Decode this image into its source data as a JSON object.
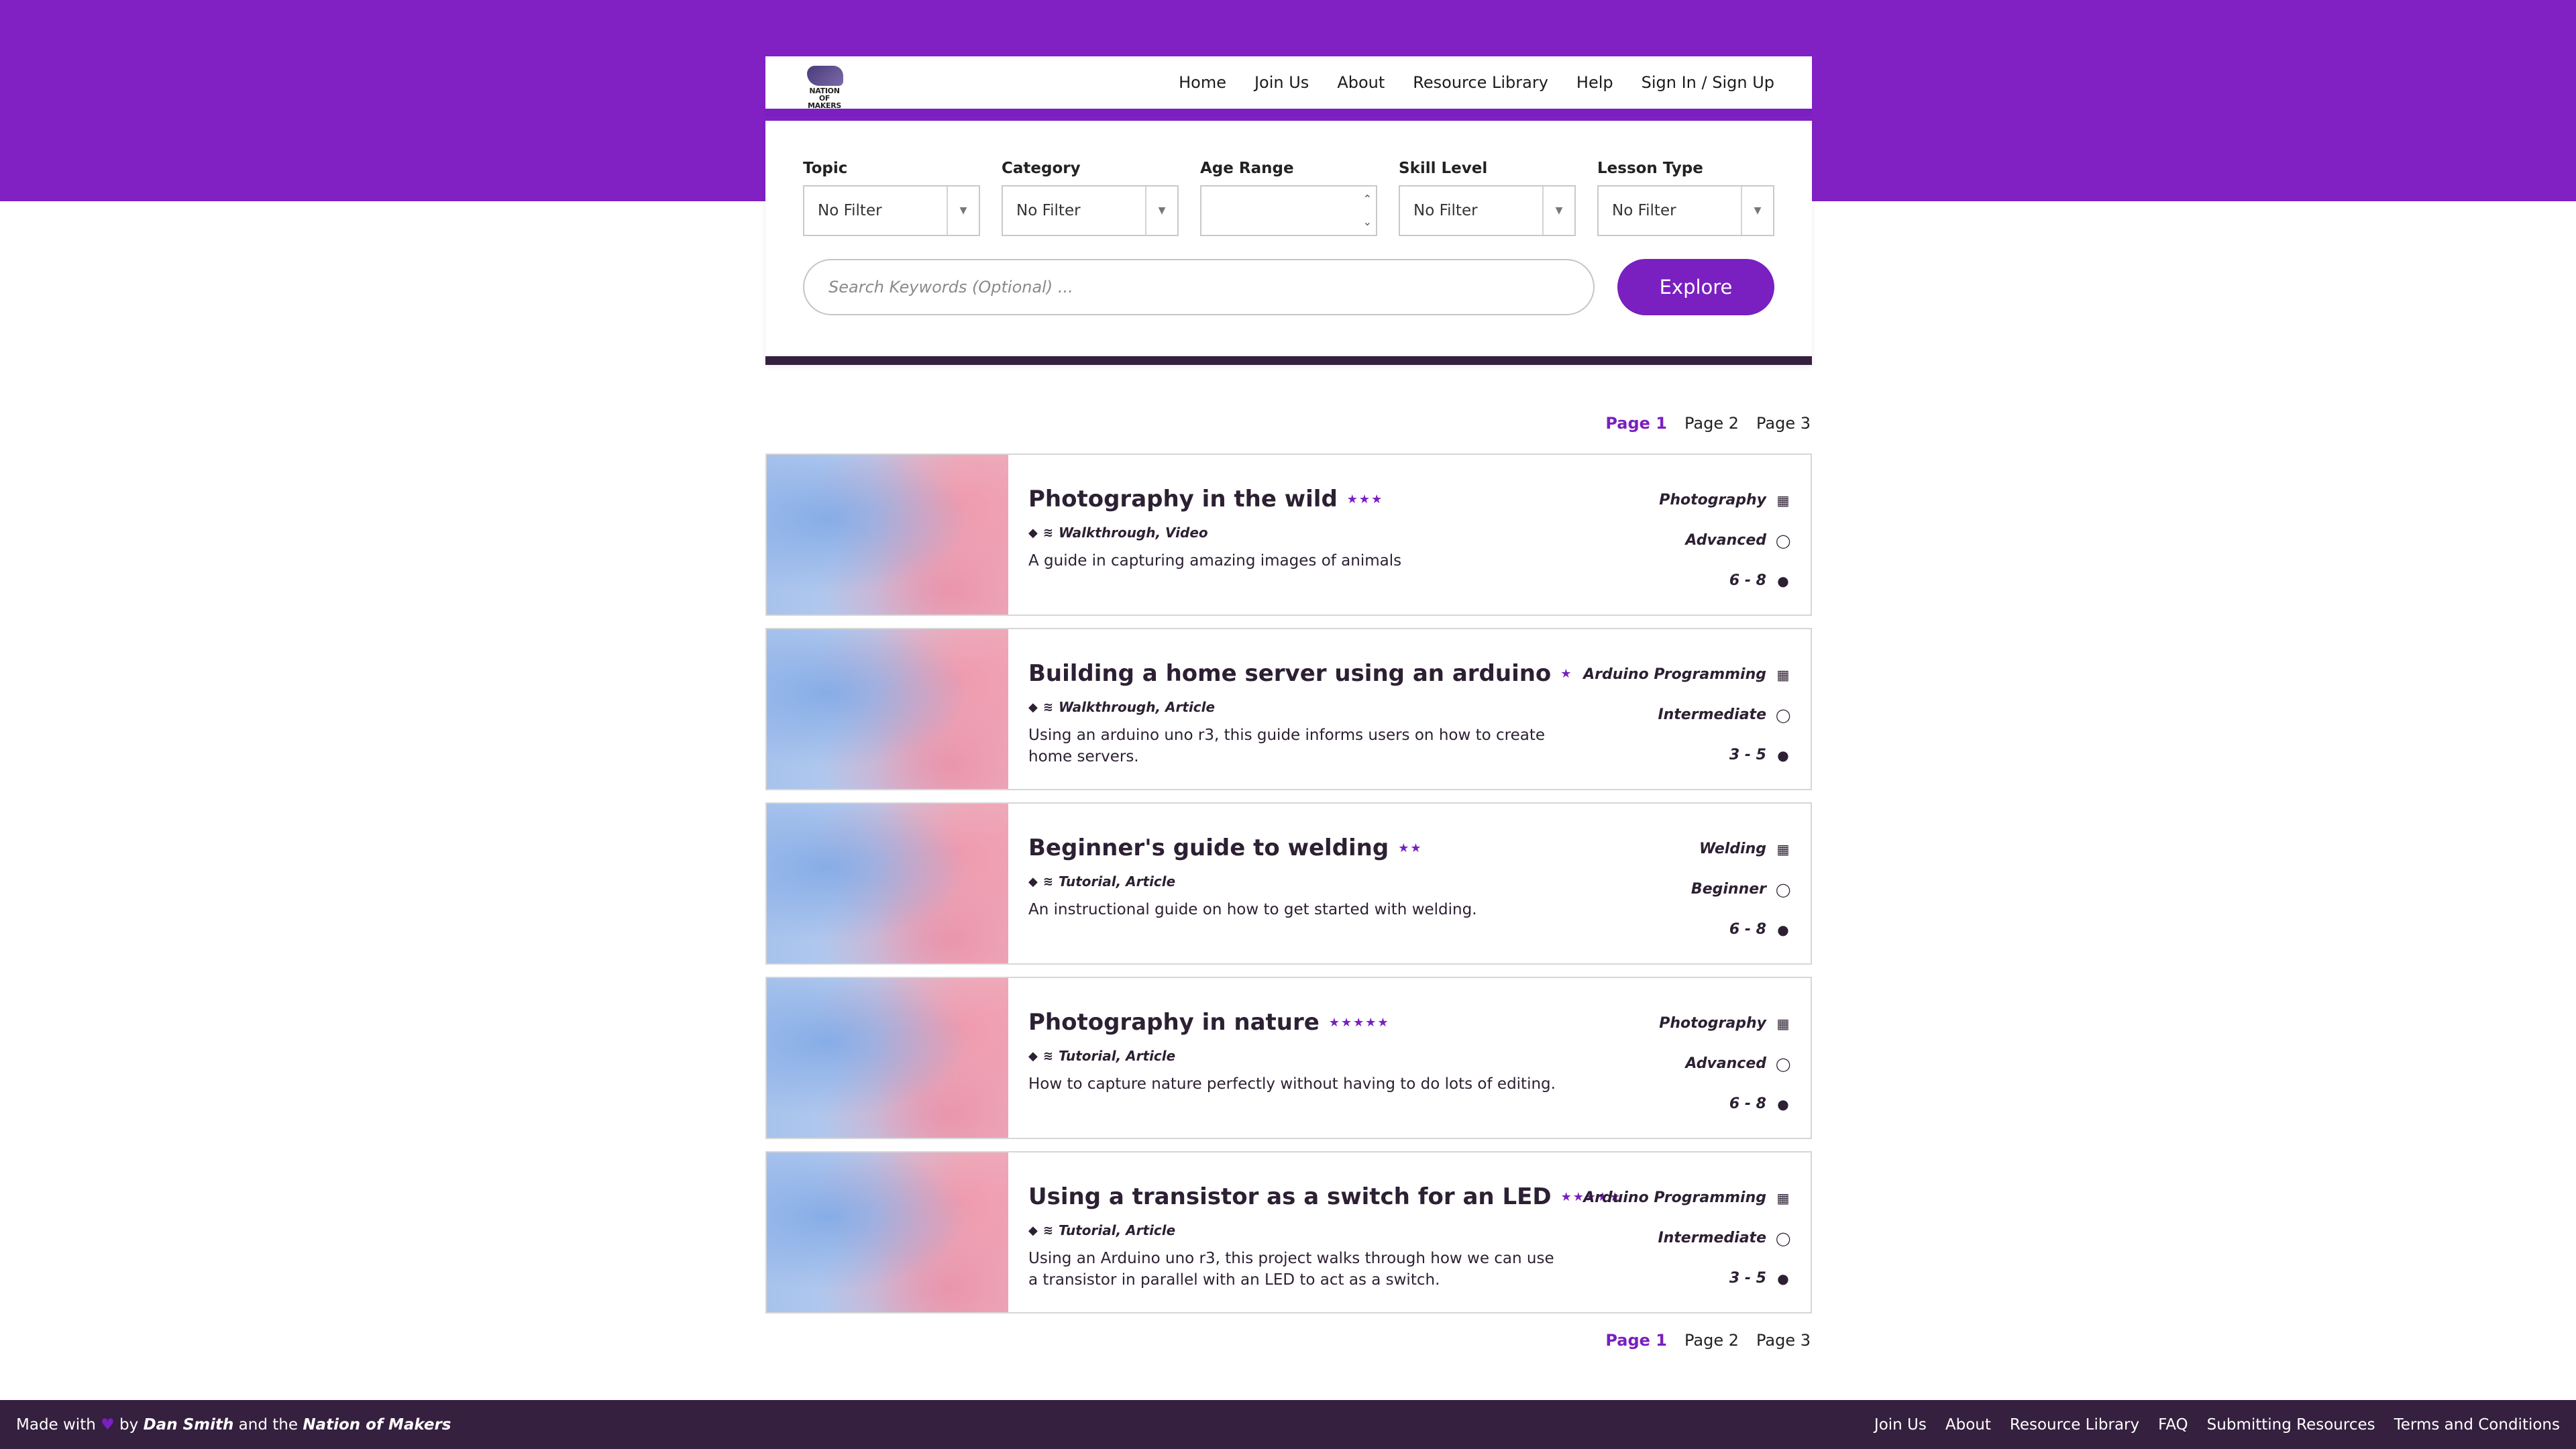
{
  "brand": {
    "logo_text": "NATION OF MAKERS"
  },
  "nav": {
    "items": [
      "Home",
      "Join Us",
      "About",
      "Resource Library",
      "Help",
      "Sign In / Sign Up"
    ]
  },
  "filters": {
    "topic": {
      "label": "Topic",
      "value": "No Filter"
    },
    "category": {
      "label": "Category",
      "value": "No Filter"
    },
    "age_range": {
      "label": "Age Range",
      "value": ""
    },
    "skill_level": {
      "label": "Skill Level",
      "value": "No Filter"
    },
    "lesson_type": {
      "label": "Lesson Type",
      "value": "No Filter"
    }
  },
  "search": {
    "placeholder": "Search Keywords (Optional) ...",
    "button": "Explore"
  },
  "pagination": {
    "pages": [
      "Page 1",
      "Page 2",
      "Page 3"
    ],
    "current": "Page 1"
  },
  "resources": [
    {
      "title": "Photography in the wild",
      "stars": "★★★",
      "types": "Walkthrough, Video",
      "description": "A guide in capturing amazing images of animals",
      "category": "Photography",
      "skill": "Advanced",
      "ages": "6 - 8"
    },
    {
      "title": "Building a home server using an arduino",
      "stars": "★",
      "types": "Walkthrough, Article",
      "description": "Using an arduino uno r3, this guide informs users on how to create home servers.",
      "category": "Arduino Programming",
      "skill": "Intermediate",
      "ages": "3 - 5"
    },
    {
      "title": "Beginner's guide to welding",
      "stars": "★★",
      "types": "Tutorial, Article",
      "description": "An instructional guide on how to get started with welding.",
      "category": "Welding",
      "skill": "Beginner",
      "ages": "6 - 8"
    },
    {
      "title": "Photography in nature",
      "stars": "★★★★★",
      "types": "Tutorial, Article",
      "description": "How to capture nature perfectly without having to do lots of editing.",
      "category": "Photography",
      "skill": "Advanced",
      "ages": "6 - 8"
    },
    {
      "title": "Using a transistor as a switch for an LED",
      "stars": "★★★★★",
      "types": "Tutorial, Article",
      "description": "Using an Arduino uno r3, this project walks through how we can use a transistor in parallel with an LED to act as a switch.",
      "category": "Arduino Programming",
      "skill": "Intermediate",
      "ages": "3 - 5"
    }
  ],
  "footer": {
    "made_prefix": "Made with",
    "made_by": "by",
    "author": "Dan Smith",
    "made_and": "and the",
    "org": "Nation of Makers",
    "links": [
      "Join Us",
      "About",
      "Resource Library",
      "FAQ",
      "Submitting Resources",
      "Terms and Conditions"
    ]
  },
  "colors": {
    "brand_purple": "#8121c4",
    "accent": "#7a1fc0",
    "dark": "#35203f"
  }
}
